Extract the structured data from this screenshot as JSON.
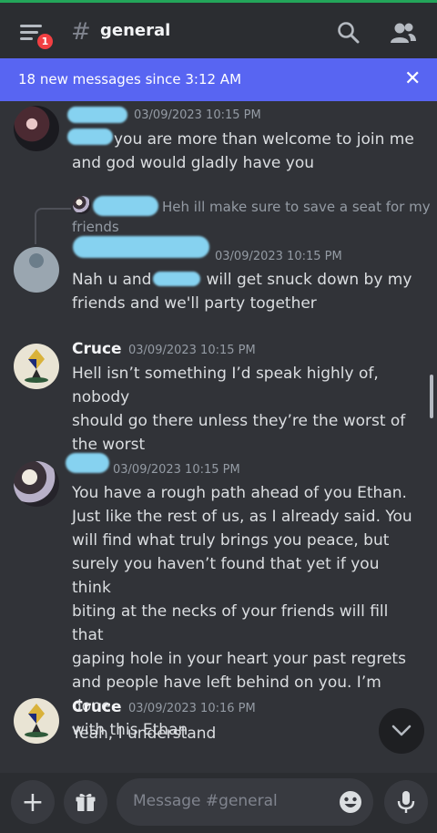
{
  "header": {
    "badge_count": "1",
    "hash_symbol": "#",
    "channel_name": "general"
  },
  "banner": {
    "text": "18 new messages since 3:12 AM",
    "close": "✕"
  },
  "messages": [
    {
      "author": "",
      "timestamp": "03/09/2023 10:15 PM",
      "lines": [
        "you are more than welcome to join me",
        "and god would gladly have you"
      ]
    },
    {
      "reply_preview": "Heh ill make sure to save a seat for my",
      "reply_preview_2": "friends",
      "author": "",
      "timestamp": "03/09/2023 10:15 PM",
      "lines": [
        "Nah u and",
        "will get snuck down by my",
        "friends and we'll party together"
      ]
    },
    {
      "author": "Cruce",
      "timestamp": "03/09/2023 10:15 PM",
      "lines": [
        "Hell isn’t something I’d speak highly of, nobody",
        "should go there unless they’re the worst of",
        "the worst"
      ]
    },
    {
      "author": "",
      "timestamp": "03/09/2023 10:15 PM",
      "lines": [
        "You have a rough path ahead of you Ethan.",
        "Just like the rest of us, as I already said. You",
        "will find what truly brings you peace, but",
        "surely you haven’t found that yet if you think",
        "biting at the necks of your friends will fill that",
        "gaping hole in your heart your past regrets",
        "and people have left behind on you. I’m done",
        "with this Ethan"
      ]
    },
    {
      "author": "Cruce",
      "timestamp": "03/09/2023 10:16 PM",
      "lines": [
        "Yeah, I understand"
      ]
    }
  ],
  "composer": {
    "placeholder": "Message #general",
    "plus": "+"
  },
  "icons": {
    "menu": "hamburger-icon",
    "search": "search-icon",
    "members": "members-icon",
    "close": "close-icon",
    "jump": "chevron-down-icon",
    "add": "plus-icon",
    "gift": "gift-icon",
    "emoji": "emoji-icon",
    "mic": "microphone-icon"
  },
  "colors": {
    "accent": "#5865f2",
    "background": "#313338",
    "header": "#2b2d31",
    "badge": "#f23f42",
    "online_bar": "#23a55a",
    "redaction": "#86d2f0"
  }
}
